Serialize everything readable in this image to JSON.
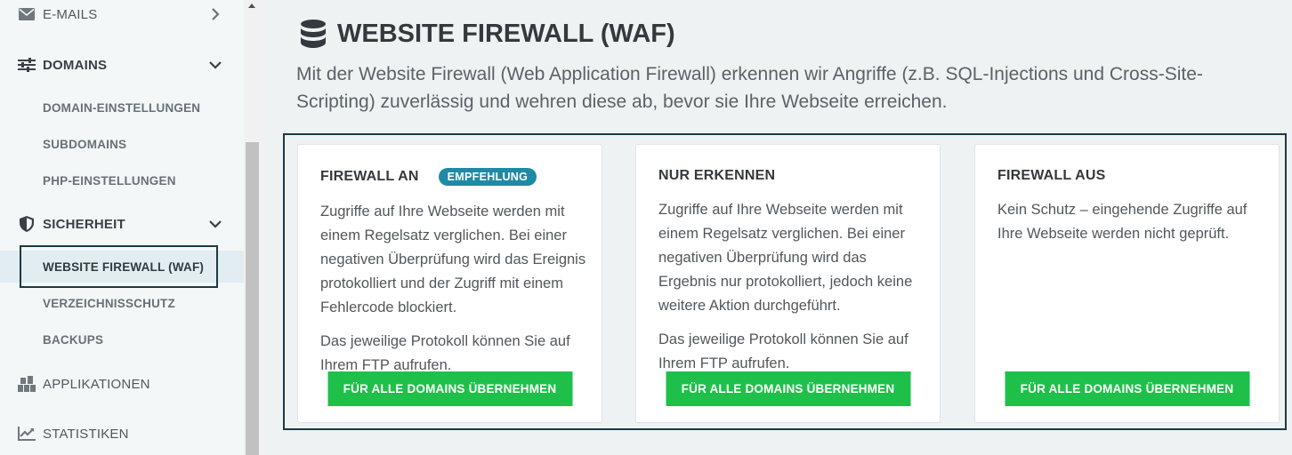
{
  "sidebar": {
    "emails": {
      "label": "E-MAILS",
      "icon": "envelope-icon"
    },
    "domains": {
      "label": "DOMAINS",
      "icon": "sliders-icon"
    },
    "domain_settings": "DOMAIN-EINSTELLUNGEN",
    "subdomains": "SUBDOMAINS",
    "php_settings": "PHP-EINSTELLUNGEN",
    "security": {
      "label": "SICHERHEIT",
      "icon": "shield-icon"
    },
    "waf": "WEBSITE FIREWALL (WAF)",
    "dir_protection": "VERZEICHNISSCHUTZ",
    "backups": "BACKUPS",
    "applications": {
      "label": "APPLIKATIONEN",
      "icon": "applications-icon"
    },
    "statistics": {
      "label": "STATISTIKEN",
      "icon": "chart-icon"
    }
  },
  "main": {
    "title": "WEBSITE FIREWALL (WAF)",
    "title_icon": "database-icon",
    "description": "Mit der Website Firewall (Web Application Firewall) erkennen wir Angriffe (z.B. SQL-Injections und Cross-Site-Scripting) zuverlässig und wehren diese ab, bevor sie Ihre Webseite erreichen.",
    "cards": [
      {
        "title": "FIREWALL AN",
        "badge": "EMPFEHLUNG",
        "p1": "Zugriffe auf Ihre Webseite werden mit einem Regelsatz verglichen. Bei einer negativen Überprüfung wird das Ereignis protokolliert und der Zugriff mit einem Fehlercode blockiert.",
        "p2": "Das jeweilige Protokoll können Sie auf Ihrem FTP aufrufen.",
        "button": "FÜR ALLE DOMAINS ÜBERNEHMEN"
      },
      {
        "title": "NUR ERKENNEN",
        "p1": "Zugriffe auf Ihre Webseite werden mit einem Regelsatz verglichen. Bei einer negativen Überprüfung wird das Ergebnis nur protokolliert, jedoch keine weitere Aktion durchgeführt.",
        "p2": "Das jeweilige Protokoll können Sie auf Ihrem FTP aufrufen.",
        "button": "FÜR ALLE DOMAINS ÜBERNEHMEN"
      },
      {
        "title": "FIREWALL AUS",
        "p1": "Kein Schutz – eingehende Zugriffe auf Ihre Webseite werden nicht geprüft.",
        "button": "FÜR ALLE DOMAINS ÜBERNEHMEN"
      }
    ]
  },
  "colors": {
    "accent_green": "#1ec04a",
    "badge_teal": "#1e8aa5",
    "focus_ring": "#1a3a44"
  }
}
